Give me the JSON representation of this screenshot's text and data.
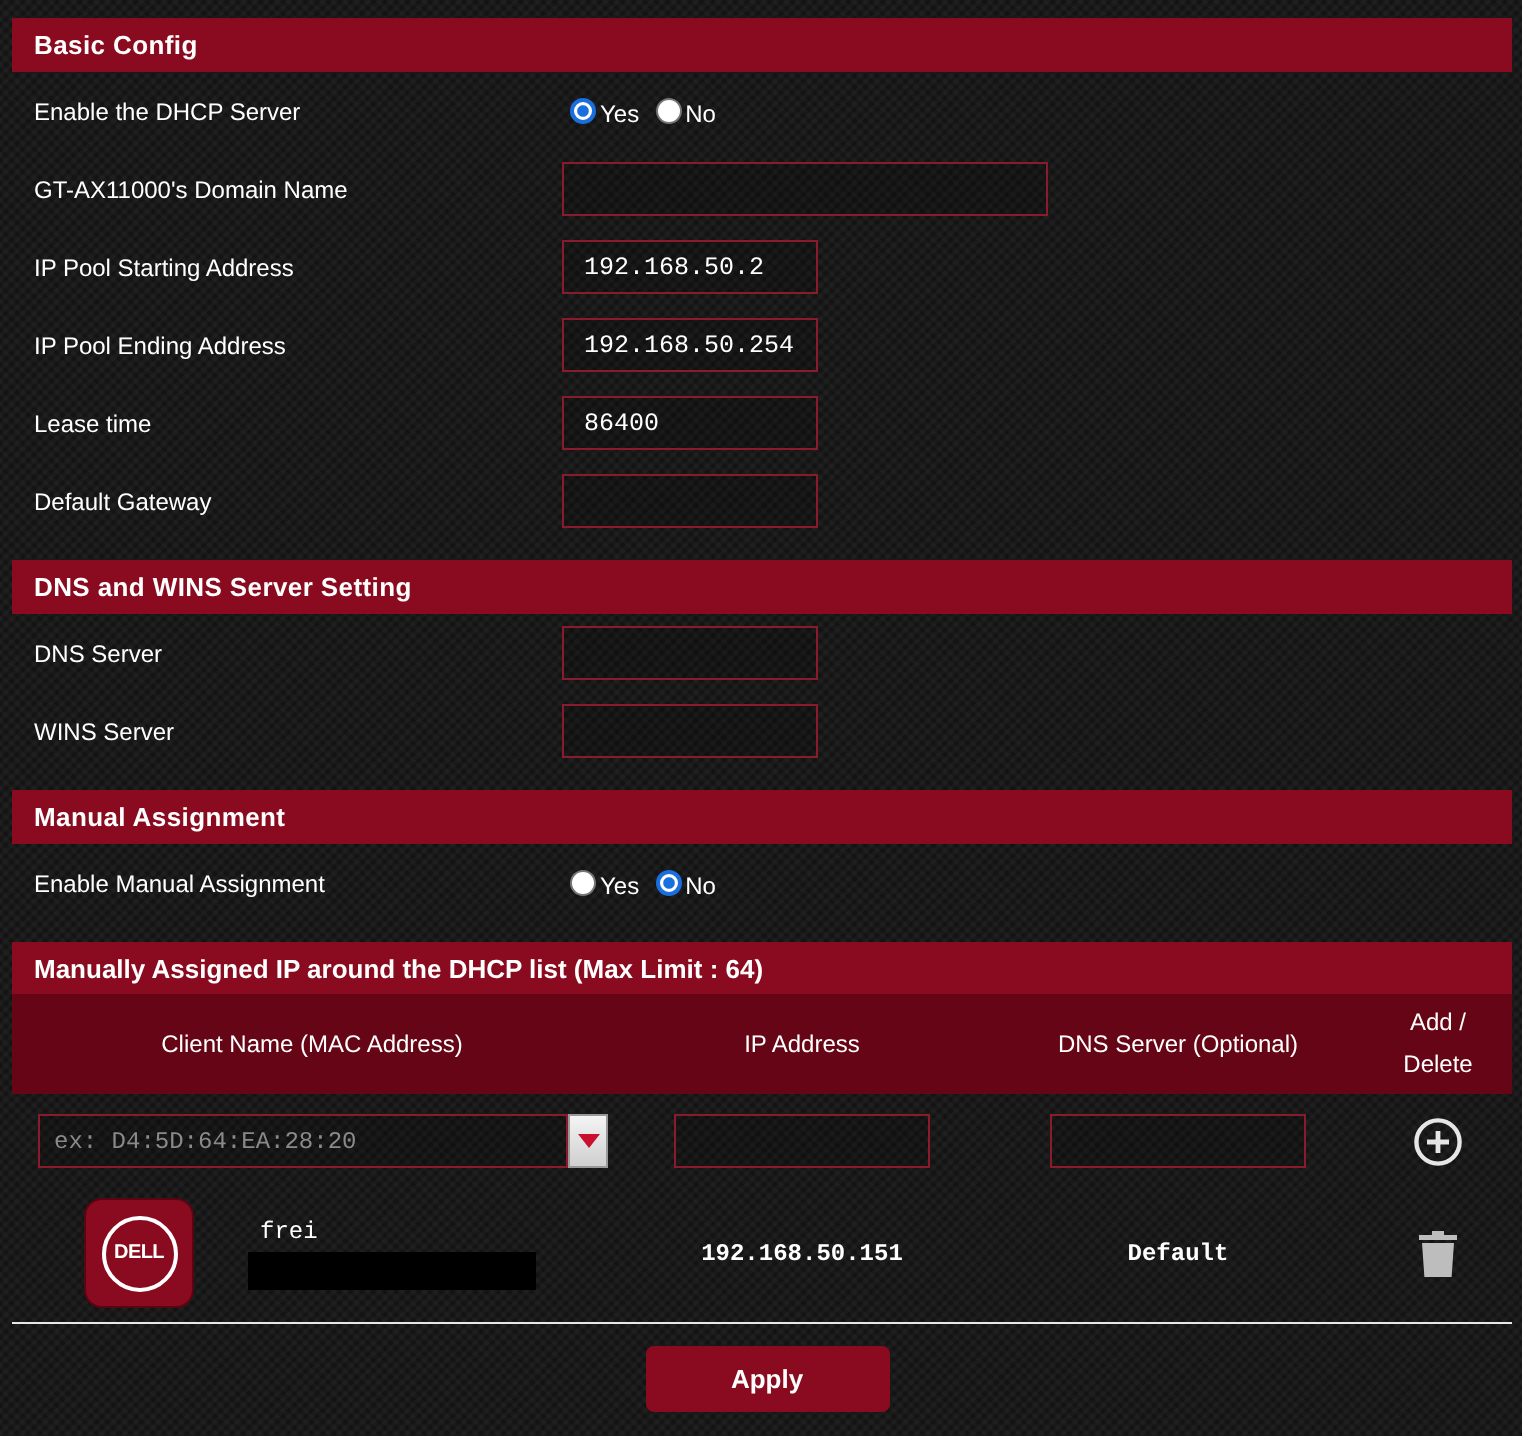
{
  "sections": [
    {
      "title": "Basic Config",
      "rows": [
        {
          "kind": "radio",
          "label": "Enable the DHCP Server",
          "options": [
            {
              "label": "Yes",
              "selected": true
            },
            {
              "label": "No",
              "selected": false
            }
          ]
        },
        {
          "kind": "wide_field",
          "label": "GT-AX11000's Domain Name"
        },
        {
          "kind": "field",
          "label": "IP Pool Starting Address",
          "value": "192.168.50.2"
        },
        {
          "kind": "field",
          "label": "IP Pool Ending Address",
          "value": "192.168.50.254"
        },
        {
          "kind": "field",
          "label": "Lease time",
          "value": "86400"
        },
        {
          "kind": "field",
          "label": "Default Gateway"
        }
      ]
    },
    {
      "title": "DNS and WINS Server Setting",
      "rows": [
        {
          "kind": "field",
          "label": "DNS Server"
        },
        {
          "kind": "field",
          "label": "WINS Server"
        }
      ]
    },
    {
      "title": "Manual Assignment",
      "rows": [
        {
          "kind": "radio",
          "label": "Enable Manual Assignment",
          "options": [
            {
              "label": "Yes",
              "selected": false
            },
            {
              "label": "No",
              "selected": true
            }
          ]
        }
      ]
    }
  ],
  "assignment_list": {
    "title": "Manually Assigned IP around the DHCP list (Max Limit : 64)",
    "columns": [
      "Client Name (MAC Address)",
      "IP Address",
      "DNS Server (Optional)",
      "Add / Delete"
    ],
    "new_entry": {
      "placeholder": "ex: D4:5D:64:EA:28:20"
    },
    "rows": [
      {
        "logo_text": "DELL",
        "name": "frei",
        "ip": "192.168.50.151",
        "dns": "Default"
      }
    ]
  },
  "apply_button": "Apply"
}
